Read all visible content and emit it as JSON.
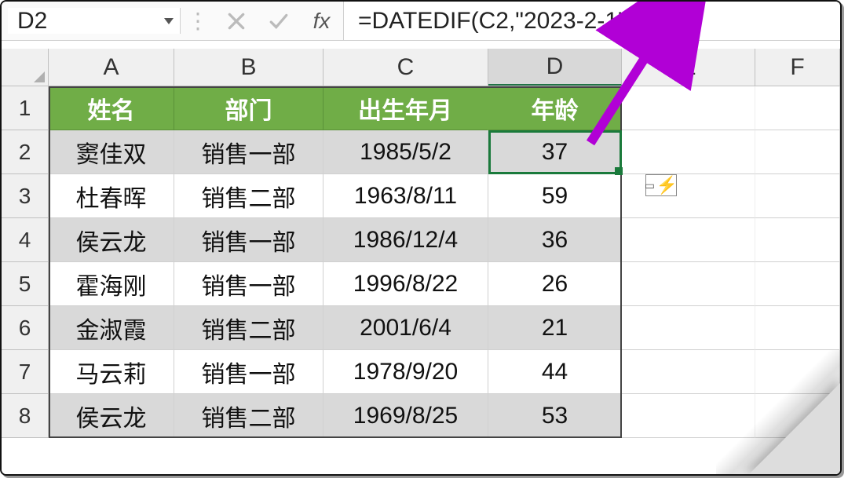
{
  "namebox": {
    "value": "D2"
  },
  "fx_label": "fx",
  "formula": "=DATEDIF(C2,\"2023-2-1\",\"y\")",
  "columns": [
    "A",
    "B",
    "C",
    "D",
    "E",
    "F"
  ],
  "active_column": "D",
  "row_numbers": [
    1,
    2,
    3,
    4,
    5,
    6,
    7,
    8
  ],
  "header_row": {
    "name": "姓名",
    "dept": "部门",
    "dob": "出生年月",
    "age": "年龄"
  },
  "table": [
    {
      "name": "窦佳双",
      "dept": "销售一部",
      "dob": "1985/5/2",
      "age": "37"
    },
    {
      "name": "杜春晖",
      "dept": "销售二部",
      "dob": "1963/8/11",
      "age": "59"
    },
    {
      "name": "侯云龙",
      "dept": "销售一部",
      "dob": "1986/12/4",
      "age": "36"
    },
    {
      "name": "霍海刚",
      "dept": "销售一部",
      "dob": "1996/8/22",
      "age": "26"
    },
    {
      "name": "金淑霞",
      "dept": "销售二部",
      "dob": "2001/6/4",
      "age": "21"
    },
    {
      "name": "马云莉",
      "dept": "销售一部",
      "dob": "1978/9/20",
      "age": "44"
    },
    {
      "name": "侯云龙",
      "dept": "销售二部",
      "dob": "1969/8/25",
      "age": "53"
    }
  ],
  "smart_tag": {
    "icon_name": "flash-fill",
    "glyph": "⚡"
  },
  "colors": {
    "accent": "#70ad47",
    "select": "#1a7a3b",
    "arrow": "#b100d6"
  }
}
